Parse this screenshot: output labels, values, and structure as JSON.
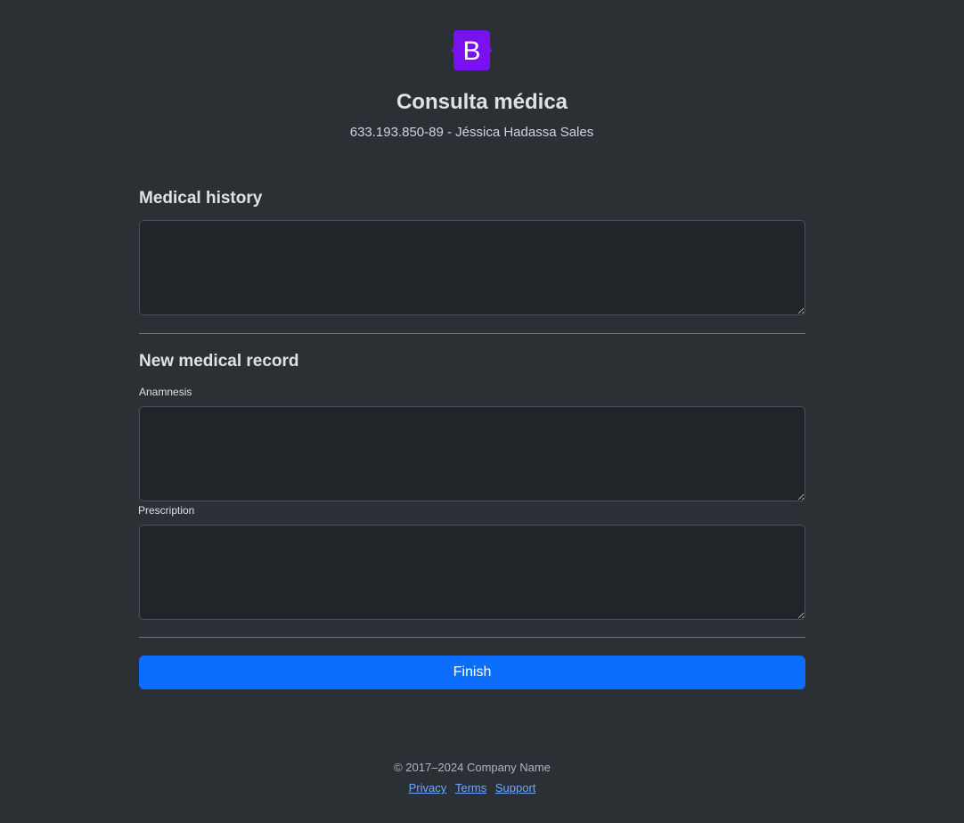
{
  "header": {
    "logo_letter": "B",
    "title": "Consulta médica",
    "subtitle": "633.193.850-89 - Jéssica Hadassa Sales"
  },
  "history": {
    "heading": "Medical history",
    "value": ""
  },
  "record": {
    "heading": "New medical record",
    "anamnesis_label": "Anamnesis",
    "anamnesis_value": "",
    "prescription_label": "Prescription",
    "prescription_value": ""
  },
  "actions": {
    "finish_label": "Finish"
  },
  "footer": {
    "copyright": "© 2017–2024 Company Name",
    "links": [
      "Privacy",
      "Terms",
      "Support"
    ]
  },
  "colors": {
    "background": "#2b3035",
    "input_background": "#212529",
    "primary": "#0d6efd",
    "brand": "#7610f2",
    "link": "#6ea8fe"
  }
}
